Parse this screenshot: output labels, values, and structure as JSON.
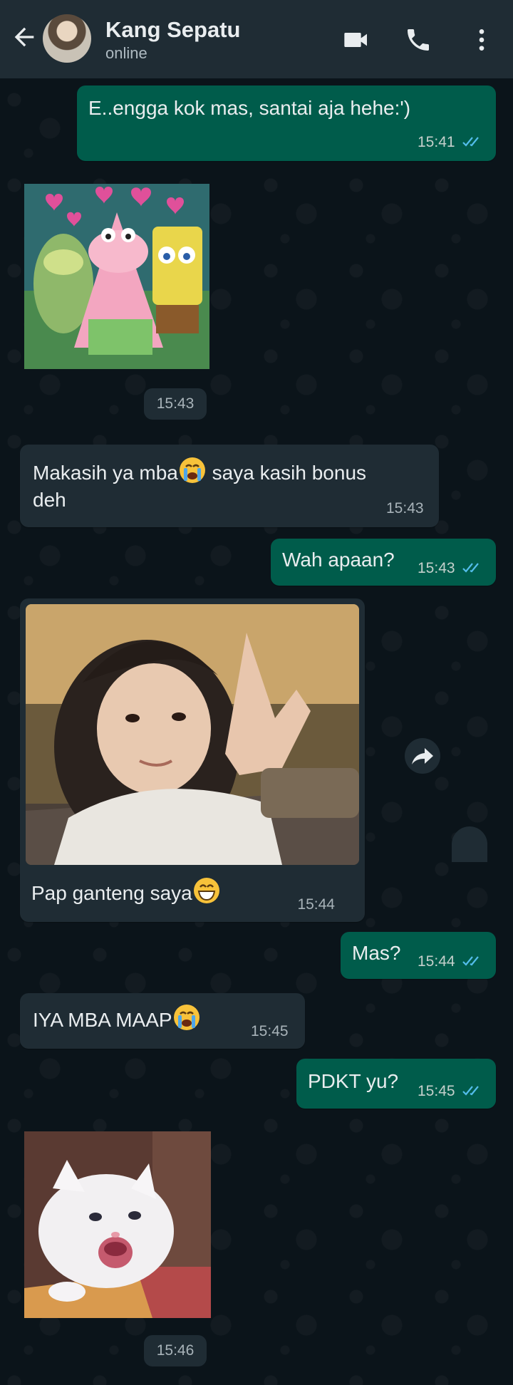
{
  "contact": {
    "name": "Kang Sepatu",
    "status": "online"
  },
  "header_icons": [
    "back-arrow-icon",
    "video-call-icon",
    "phone-icon",
    "more-vert-icon"
  ],
  "colors": {
    "header": "#1f2c34",
    "outgoing": "#005c4b",
    "incoming": "#1f2c34",
    "background": "#0b141a",
    "read_ticks": "#53bdeb"
  },
  "messages": [
    {
      "dir": "out",
      "text": "E..engga kok mas, santai aja hehe:')",
      "time": "15:41",
      "status": "read"
    },
    {
      "dir": "in",
      "type": "sticker",
      "sticker": "spongebob-patrick-hearts",
      "time": "15:43"
    },
    {
      "dir": "in",
      "text": "Makasih ya mba",
      "text_after_emoji": " saya kasih bonus",
      "text_line2": "deh",
      "emoji": "loudly-crying-face",
      "time": "15:43"
    },
    {
      "dir": "out",
      "text": "Wah apaan?",
      "time": "15:43",
      "status": "read"
    },
    {
      "dir": "in",
      "type": "photo",
      "photo": "selfie-peace-sign",
      "caption": "Pap ganteng saya",
      "emoji": "grinning-face",
      "time": "15:44"
    },
    {
      "dir": "out",
      "text": "Mas?",
      "time": "15:44",
      "status": "read"
    },
    {
      "dir": "in",
      "text": "IYA MBA MAAP",
      "emoji": "loudly-crying-face",
      "time": "15:45"
    },
    {
      "dir": "out",
      "text": "PDKT yu?",
      "time": "15:45",
      "status": "read"
    },
    {
      "dir": "in",
      "type": "sticker",
      "sticker": "crying-kitten",
      "time": "15:46"
    }
  ]
}
